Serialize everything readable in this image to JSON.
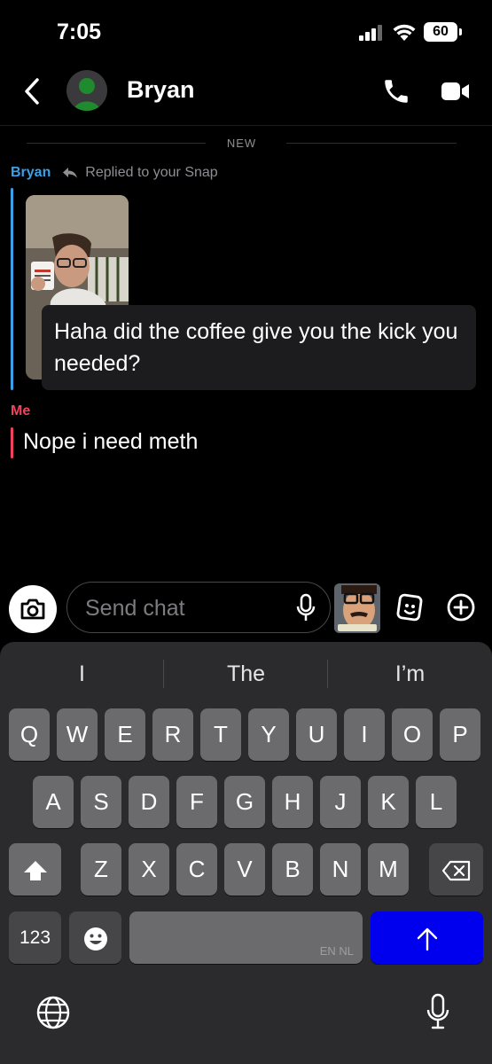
{
  "status_bar": {
    "time": "7:05",
    "battery": "60"
  },
  "header": {
    "contact_name": "Bryan"
  },
  "chat": {
    "divider_label": "NEW",
    "reply": {
      "sender": "Bryan",
      "reply_label": "Replied to your Snap"
    },
    "snap_caption": "Haha did the coffee give you the kick you needed?",
    "me": {
      "sender": "Me",
      "message": "Nope i need meth"
    }
  },
  "composer": {
    "placeholder": "Send chat"
  },
  "keyboard": {
    "suggestions": [
      "I",
      "The",
      "I’m"
    ],
    "row1": [
      "Q",
      "W",
      "E",
      "R",
      "T",
      "Y",
      "U",
      "I",
      "O",
      "P"
    ],
    "row2": [
      "A",
      "S",
      "D",
      "F",
      "G",
      "H",
      "J",
      "K",
      "L"
    ],
    "row3": [
      "Z",
      "X",
      "C",
      "V",
      "B",
      "N",
      "M"
    ],
    "numbers_label": "123",
    "space_sub_label": "EN NL",
    "return_color": "#0000ee"
  },
  "colors": {
    "bryan": "#3aa0e8",
    "me": "#f2425c",
    "avatar_figure": "#1f8a2e"
  }
}
